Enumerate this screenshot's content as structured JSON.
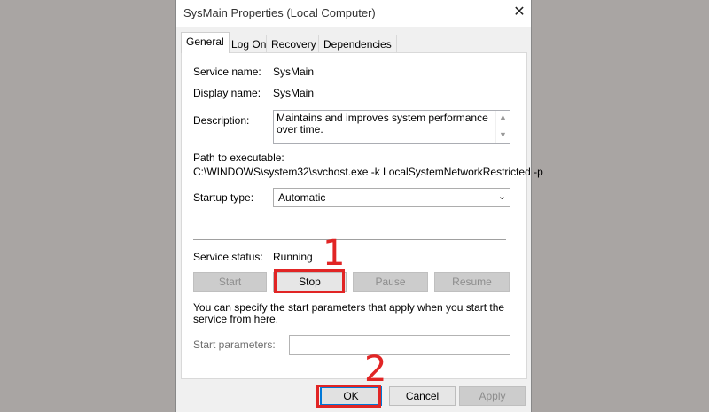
{
  "window": {
    "title": "SysMain Properties (Local Computer)",
    "close_glyph": "✕"
  },
  "tabs": [
    {
      "label": "General",
      "active": true
    },
    {
      "label": "Log On",
      "active": false
    },
    {
      "label": "Recovery",
      "active": false
    },
    {
      "label": "Dependencies",
      "active": false
    }
  ],
  "general": {
    "service_name_label": "Service name:",
    "service_name_value": "SysMain",
    "display_name_label": "Display name:",
    "display_name_value": "SysMain",
    "description_label": "Description:",
    "description_value": "Maintains and improves system performance over time.",
    "path_label": "Path to executable:",
    "path_value": "C:\\WINDOWS\\system32\\svchost.exe -k LocalSystemNetworkRestricted -p",
    "startup_type_label": "Startup type:",
    "startup_type_value": "Automatic",
    "status_label": "Service status:",
    "status_value": "Running",
    "buttons": {
      "start": "Start",
      "stop": "Stop",
      "pause": "Pause",
      "resume": "Resume"
    },
    "params_hint": "You can specify the start parameters that apply when you start the service from here.",
    "params_label": "Start parameters:",
    "params_value": ""
  },
  "footer": {
    "ok": "OK",
    "cancel": "Cancel",
    "apply": "Apply"
  },
  "annotations": {
    "step1": "1",
    "step2": "2",
    "color": "#e12525"
  }
}
